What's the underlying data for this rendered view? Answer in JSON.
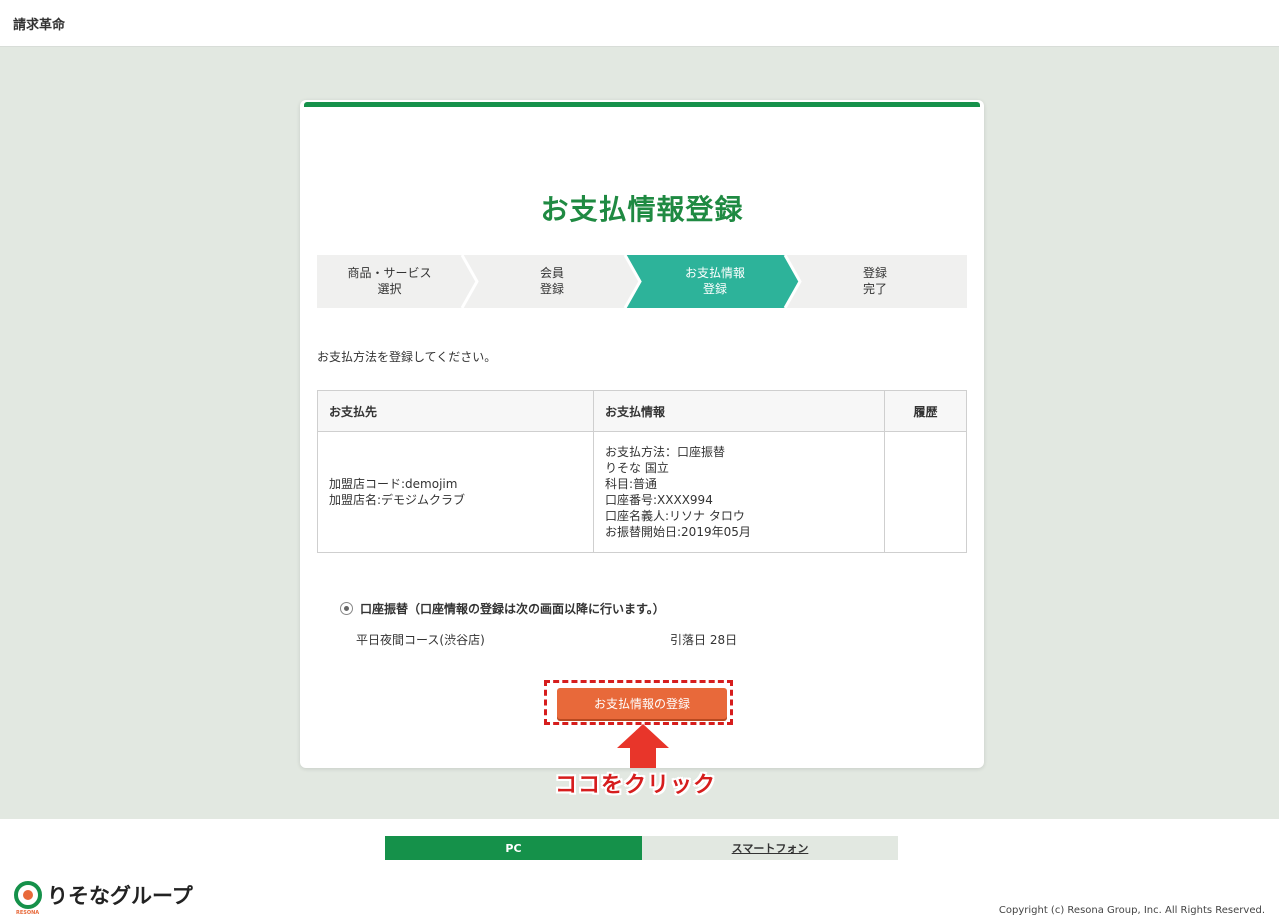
{
  "header": {
    "brand": "請求革命"
  },
  "page": {
    "title": "お支払情報登録",
    "intro": "お支払方法を登録してください。"
  },
  "steps": [
    {
      "line1": "商品・サービス",
      "line2": "選択",
      "active": false
    },
    {
      "line1": "会員",
      "line2": "登録",
      "active": false
    },
    {
      "line1": "お支払情報",
      "line2": "登録",
      "active": true
    },
    {
      "line1": "登録",
      "line2": "完了",
      "active": false
    }
  ],
  "table": {
    "headers": {
      "payee": "お支払先",
      "payment_info": "お支払情報",
      "history": "履歴"
    },
    "payee_lines": [
      "加盟店コード:demojim",
      "加盟店名:デモジムクラブ"
    ],
    "payment_lines": [
      "お支払方法：口座振替",
      "りそな 国立",
      "科目:普通",
      "口座番号:XXXX994",
      "口座名義人:リソナ タロウ",
      "お振替開始日:2019年05月"
    ],
    "history": ""
  },
  "payment_option": {
    "label": "口座振替（口座情報の登録は次の画面以降に行います。）",
    "course": "平日夜間コース(渋谷店)",
    "debit_day": "引落日 28日"
  },
  "submit_button": "お支払情報の登録",
  "annotation": "ココをクリック",
  "footer": {
    "pc": "PC",
    "smartphone": "スマートフォン",
    "logo_text": "りそなグループ",
    "logo_sub": "RESONA",
    "copyright": "Copyright (c) Resona Group, Inc. All Rights Reserved."
  },
  "colors": {
    "brand_green": "#15914a",
    "active_step": "#2db39a",
    "accent_orange": "#e8693a",
    "annotation_red": "#d61d1d"
  }
}
